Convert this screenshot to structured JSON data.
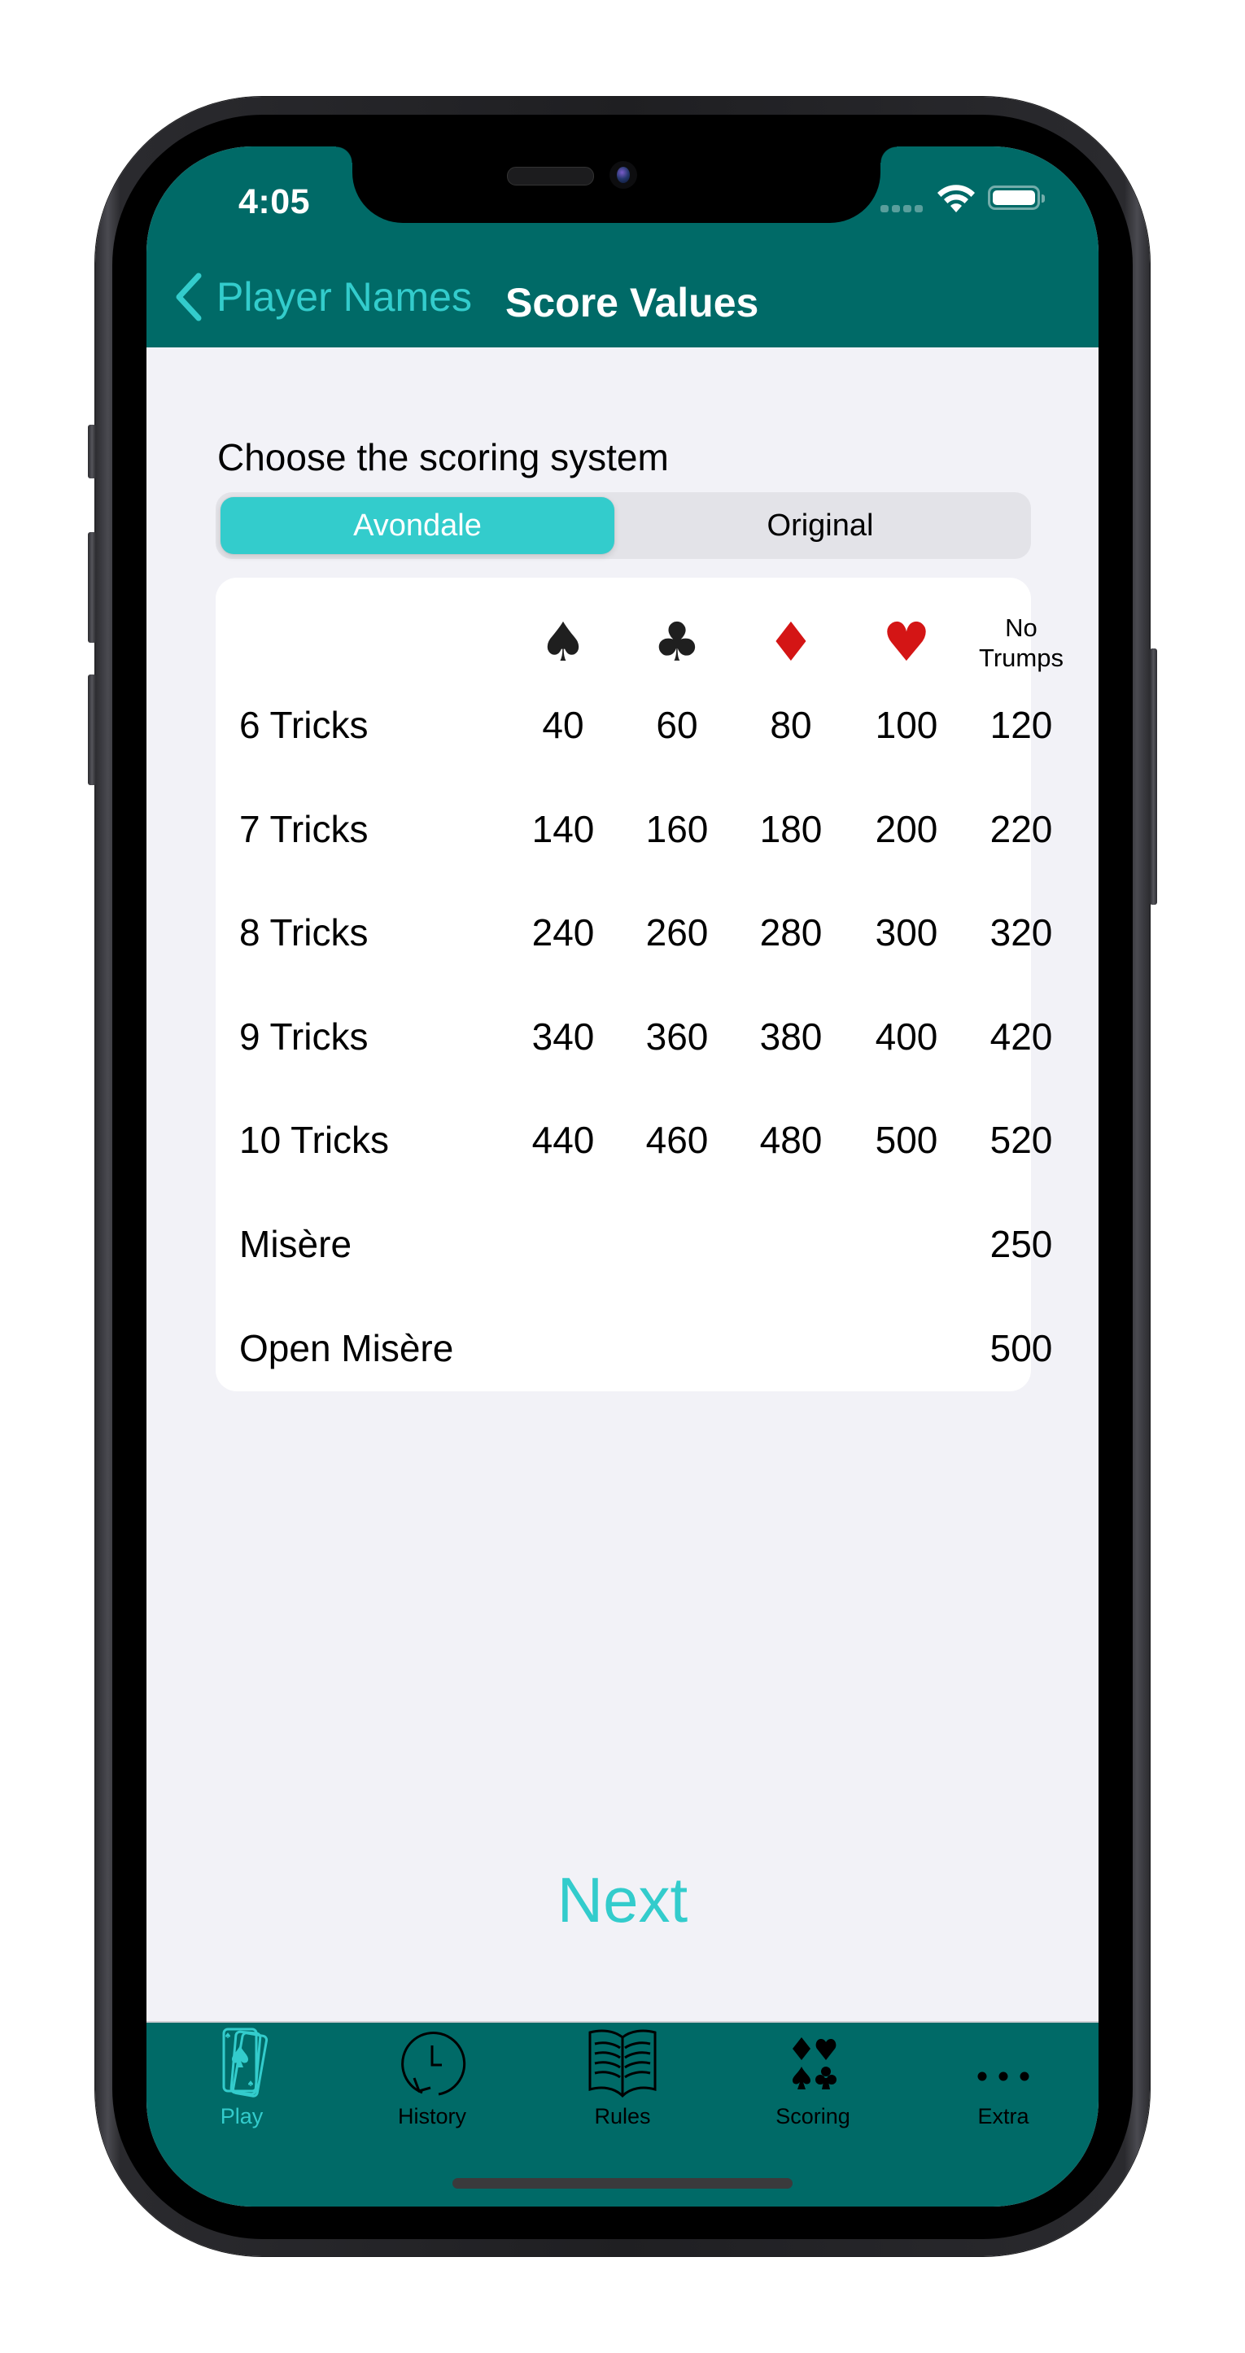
{
  "status_bar": {
    "time": "4:05",
    "signal_icon": "signal-dots-icon",
    "wifi_icon": "wifi-icon",
    "battery_icon": "battery-full-icon"
  },
  "nav": {
    "back_label": "Player Names",
    "back_icon": "chevron-left-icon",
    "title": "Score Values"
  },
  "content": {
    "section_label": "Choose the scoring system",
    "segments": [
      {
        "label": "Avondale",
        "selected": true
      },
      {
        "label": "Original",
        "selected": false
      }
    ],
    "table": {
      "columns": [
        {
          "icon": "spade-icon",
          "glyph": "♠"
        },
        {
          "icon": "club-icon",
          "glyph": "♣"
        },
        {
          "icon": "diamond-icon",
          "glyph": "♦"
        },
        {
          "icon": "heart-icon",
          "glyph": "♥"
        },
        {
          "line1": "No",
          "line2": "Trumps"
        }
      ],
      "rows": [
        {
          "label": "6 Tricks",
          "values": [
            "40",
            "60",
            "80",
            "100",
            "120"
          ]
        },
        {
          "label": "7 Tricks",
          "values": [
            "140",
            "160",
            "180",
            "200",
            "220"
          ]
        },
        {
          "label": "8 Tricks",
          "values": [
            "240",
            "260",
            "280",
            "300",
            "320"
          ]
        },
        {
          "label": "9 Tricks",
          "values": [
            "340",
            "360",
            "380",
            "400",
            "420"
          ]
        },
        {
          "label": "10 Tricks",
          "values": [
            "440",
            "460",
            "480",
            "500",
            "520"
          ]
        },
        {
          "label": "Misère",
          "values": [
            "",
            "",
            "",
            "",
            "250"
          ]
        },
        {
          "label": "Open Misère",
          "values": [
            "",
            "",
            "",
            "",
            "500"
          ]
        }
      ]
    },
    "next_label": "Next"
  },
  "tabbar": {
    "items": [
      {
        "label": "Play",
        "icon": "playing-cards-icon",
        "active": true
      },
      {
        "label": "History",
        "icon": "history-clock-icon",
        "active": false
      },
      {
        "label": "Rules",
        "icon": "open-book-icon",
        "active": false
      },
      {
        "label": "Scoring",
        "icon": "card-suits-icon",
        "active": false
      },
      {
        "label": "Extra",
        "icon": "more-dots-icon",
        "active": false
      }
    ]
  },
  "colors": {
    "header": "#006a67",
    "accent": "#33cccc",
    "background": "#f2f2f7",
    "segment_track": "#e3e3e8"
  }
}
